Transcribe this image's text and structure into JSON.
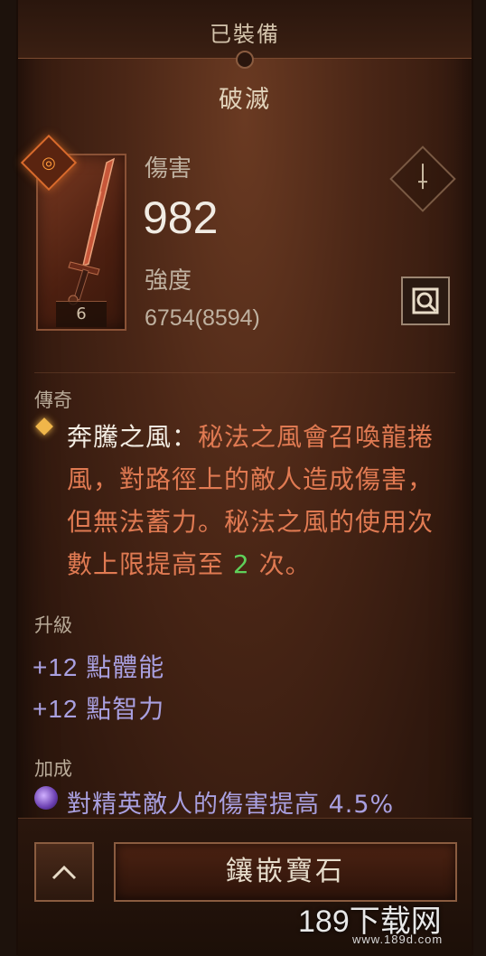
{
  "header": {
    "equipped_label": "已裝備"
  },
  "item": {
    "name": "破滅",
    "level": "6",
    "damage_label": "傷害",
    "damage_value": "982",
    "strength_label": "強度",
    "strength_value": "6754(8594)"
  },
  "legendary": {
    "heading": "傳奇",
    "power_name": "奔騰之風",
    "separator": "：",
    "desc_part1": "秘法之風會召喚龍捲風，對路徑上的敵人造成傷害，但無法蓄力。秘法之風的使用次數上限提高至 ",
    "desc_number": "2",
    "desc_part2": " 次。"
  },
  "upgrades": {
    "heading": "升級",
    "lines": [
      "+12 點體能",
      "+12 點智力"
    ]
  },
  "bonus": {
    "heading": "加成",
    "line": "對精英敵人的傷害提高 4.5%"
  },
  "footer": {
    "socket_button_label": "鑲嵌寶石"
  },
  "watermark": {
    "brand": "189下载网",
    "url": "www.189d.com"
  },
  "colors": {
    "legendary_text": "#e07a52",
    "upgrade_text": "#a9a0e0",
    "highlight_number": "#5fd05a"
  }
}
